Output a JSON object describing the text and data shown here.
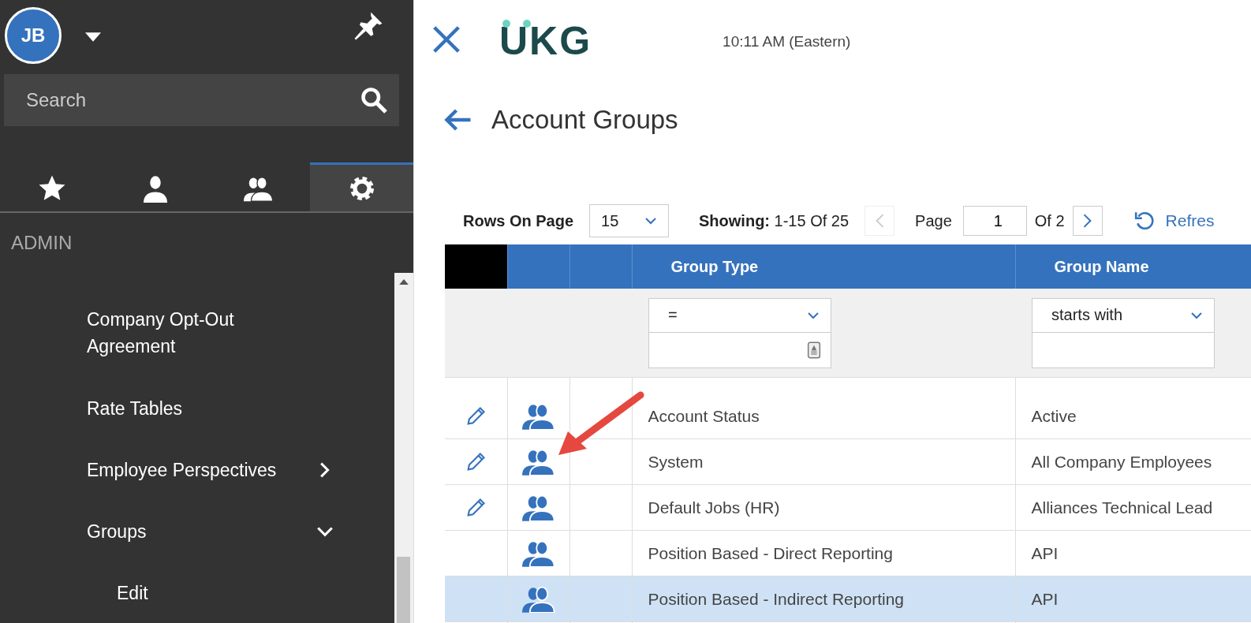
{
  "user": {
    "initials": "JB"
  },
  "search": {
    "placeholder": "Search"
  },
  "nav_tabs": [
    {
      "kind": "favorites",
      "selected": false
    },
    {
      "kind": "myself",
      "selected": false
    },
    {
      "kind": "team",
      "selected": false
    },
    {
      "kind": "admin",
      "selected": true
    }
  ],
  "section_title": "ADMIN",
  "menu": [
    {
      "label": "Company Opt-Out Agreement"
    },
    {
      "label": "Rate Tables"
    },
    {
      "label": "Employee Perspectives",
      "expanded": false
    },
    {
      "label": "Groups",
      "expanded": true,
      "children": [
        {
          "label": "Edit"
        }
      ]
    }
  ],
  "header": {
    "logo": "UKG",
    "time": "10:11 AM (Eastern)"
  },
  "page_title": "Account Groups",
  "toolbar": {
    "rows_label": "Rows On Page",
    "rows_value": "15",
    "showing": "**Showing:** 1-15 Of 25",
    "prev_disabled": true,
    "page_label": "Page",
    "page_value": "1",
    "page_total": "Of 2",
    "next_disabled": false,
    "refresh": "Refres"
  },
  "table": {
    "columns": [
      {
        "label": "Group Type",
        "filter": "="
      },
      {
        "label": "Group Name",
        "filter": "starts with"
      }
    ],
    "rows": [
      {
        "editable": true,
        "selected": false,
        "cells": [
          "Account Status",
          "Active"
        ]
      },
      {
        "editable": true,
        "selected": false,
        "cells": [
          "System",
          "All Company Employees"
        ]
      },
      {
        "editable": true,
        "selected": false,
        "cells": [
          "Default Jobs (HR)",
          "Alliances Technical Lead"
        ]
      },
      {
        "editable": false,
        "selected": false,
        "cells": [
          "Position Based - Direct Reporting",
          "API"
        ]
      },
      {
        "editable": false,
        "selected": true,
        "cells": [
          "Position Based - Indirect Reporting",
          "API"
        ]
      }
    ]
  }
}
